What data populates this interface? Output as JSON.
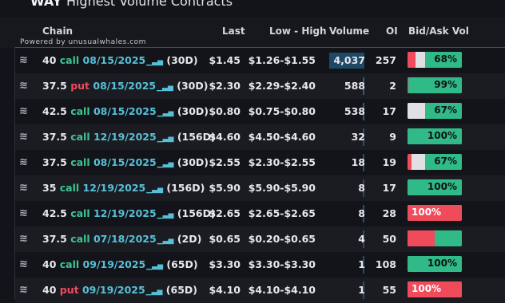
{
  "title": {
    "ticker": "WAY",
    "text": "Highest Volume Contracts"
  },
  "powered_by": "Powered by unusualwhales.com",
  "headers": {
    "chain": "Chain",
    "last": "Last",
    "low_high": "Low - High",
    "volume": "Volume",
    "oi": "OI",
    "bid_ask": "Bid/Ask Vol"
  },
  "colors": {
    "call": "#3ec491",
    "put": "#ef4b5b",
    "date": "#56c0d8",
    "ask": "#2fba88",
    "bid": "#ef4b5b",
    "mid": "#e0e0e4",
    "volume_bar": "#1d4866"
  },
  "rows": [
    {
      "strike": "40",
      "type": "call",
      "date": "08/15/2025",
      "dte": "(30D)",
      "last": "$1.45",
      "range": "$1.26-$1.55",
      "volume": "4,037",
      "vol_pct": 100,
      "oi": "257",
      "bid_pct": 0.14,
      "mid_pct": 0.18,
      "ask_pct": 0.68,
      "label": "68%",
      "label_side": "ask"
    },
    {
      "strike": "37.5",
      "type": "put",
      "date": "08/15/2025",
      "dte": "(30D)",
      "last": "$2.30",
      "range": "$2.29-$2.40",
      "volume": "588",
      "vol_pct": 15,
      "oi": "2",
      "bid_pct": 0.01,
      "mid_pct": 0.0,
      "ask_pct": 0.99,
      "label": "99%",
      "label_side": "ask"
    },
    {
      "strike": "42.5",
      "type": "call",
      "date": "08/15/2025",
      "dte": "(30D)",
      "last": "$0.80",
      "range": "$0.75-$0.80",
      "volume": "538",
      "vol_pct": 13,
      "oi": "17",
      "bid_pct": 0.0,
      "mid_pct": 0.33,
      "ask_pct": 0.67,
      "label": "67%",
      "label_side": "ask"
    },
    {
      "strike": "37.5",
      "type": "call",
      "date": "12/19/2025",
      "dte": "(156D)",
      "last": "$4.60",
      "range": "$4.50-$4.60",
      "volume": "32",
      "vol_pct": 1,
      "oi": "9",
      "bid_pct": 0.0,
      "mid_pct": 0.0,
      "ask_pct": 1.0,
      "label": "100%",
      "label_side": "ask"
    },
    {
      "strike": "37.5",
      "type": "call",
      "date": "08/15/2025",
      "dte": "(30D)",
      "last": "$2.55",
      "range": "$2.30-$2.55",
      "volume": "18",
      "vol_pct": 0.5,
      "oi": "19",
      "bid_pct": 0.08,
      "mid_pct": 0.25,
      "ask_pct": 0.67,
      "label": "67%",
      "label_side": "ask"
    },
    {
      "strike": "35",
      "type": "call",
      "date": "12/19/2025",
      "dte": "(156D)",
      "last": "$5.90",
      "range": "$5.90-$5.90",
      "volume": "8",
      "vol_pct": 0.2,
      "oi": "17",
      "bid_pct": 0.0,
      "mid_pct": 0.0,
      "ask_pct": 1.0,
      "label": "100%",
      "label_side": "ask"
    },
    {
      "strike": "42.5",
      "type": "call",
      "date": "12/19/2025",
      "dte": "(156D)",
      "last": "$2.65",
      "range": "$2.65-$2.65",
      "volume": "8",
      "vol_pct": 0.2,
      "oi": "28",
      "bid_pct": 1.0,
      "mid_pct": 0.0,
      "ask_pct": 0.0,
      "label": "100%",
      "label_side": "bid"
    },
    {
      "strike": "37.5",
      "type": "call",
      "date": "07/18/2025",
      "dte": "(2D)",
      "last": "$0.65",
      "range": "$0.20-$0.65",
      "volume": "4",
      "vol_pct": 0.1,
      "oi": "50",
      "bid_pct": 0.5,
      "mid_pct": 0.0,
      "ask_pct": 0.5,
      "label": "",
      "label_side": "none"
    },
    {
      "strike": "40",
      "type": "call",
      "date": "09/19/2025",
      "dte": "(65D)",
      "last": "$3.30",
      "range": "$3.30-$3.30",
      "volume": "1",
      "vol_pct": 0.05,
      "oi": "108",
      "bid_pct": 0.0,
      "mid_pct": 0.0,
      "ask_pct": 1.0,
      "label": "100%",
      "label_side": "ask"
    },
    {
      "strike": "40",
      "type": "put",
      "date": "09/19/2025",
      "dte": "(65D)",
      "last": "$4.10",
      "range": "$4.10-$4.10",
      "volume": "1",
      "vol_pct": 0.05,
      "oi": "55",
      "bid_pct": 1.0,
      "mid_pct": 0.0,
      "ask_pct": 0.0,
      "label": "100%",
      "label_side": "bid"
    }
  ]
}
